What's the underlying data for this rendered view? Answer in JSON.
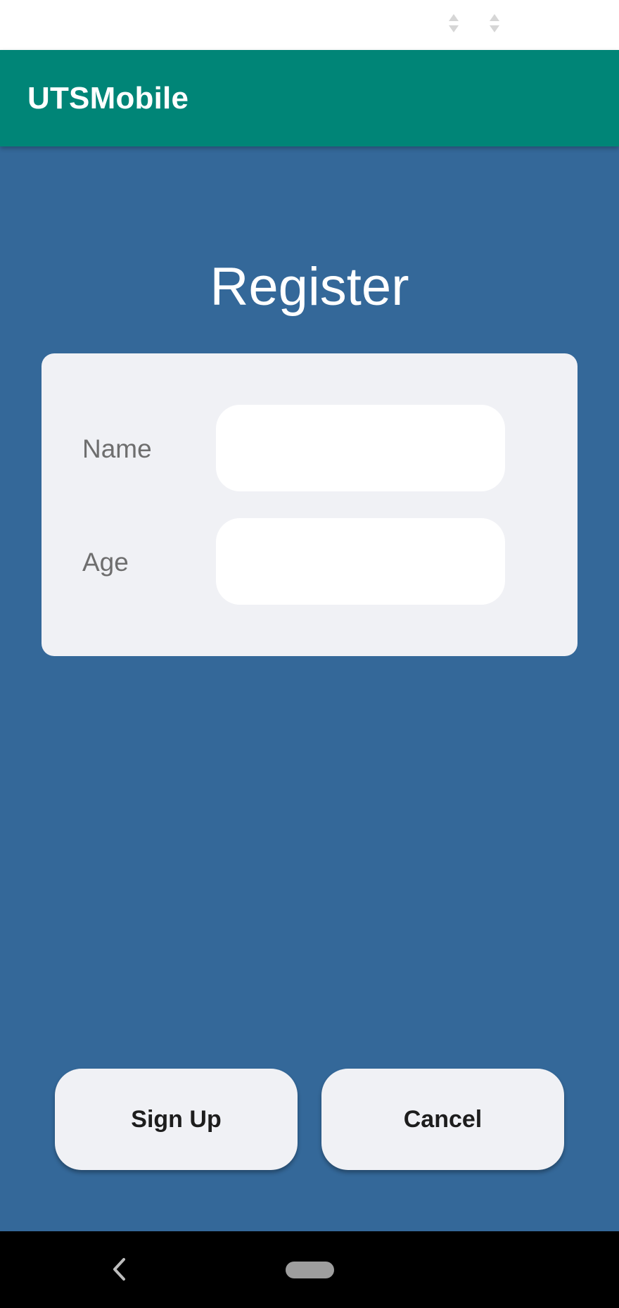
{
  "status_bar": {
    "icons": [
      "signal-arrows-icon",
      "signal-arrows-icon"
    ]
  },
  "app_bar": {
    "title": "UTSMobile"
  },
  "page": {
    "title": "Register"
  },
  "form": {
    "fields": [
      {
        "label": "Name",
        "value": "",
        "placeholder": ""
      },
      {
        "label": "Age",
        "value": "",
        "placeholder": ""
      }
    ]
  },
  "actions": {
    "signup_label": "Sign Up",
    "cancel_label": "Cancel"
  },
  "nav": {
    "icons": [
      "back-icon",
      "home-pill-icon"
    ]
  },
  "colors": {
    "background": "#346899",
    "app_bar": "#008577",
    "card": "#f0f1f5",
    "input": "#ffffff",
    "label": "#6e6e6e",
    "button_text": "#1d1d1d"
  }
}
